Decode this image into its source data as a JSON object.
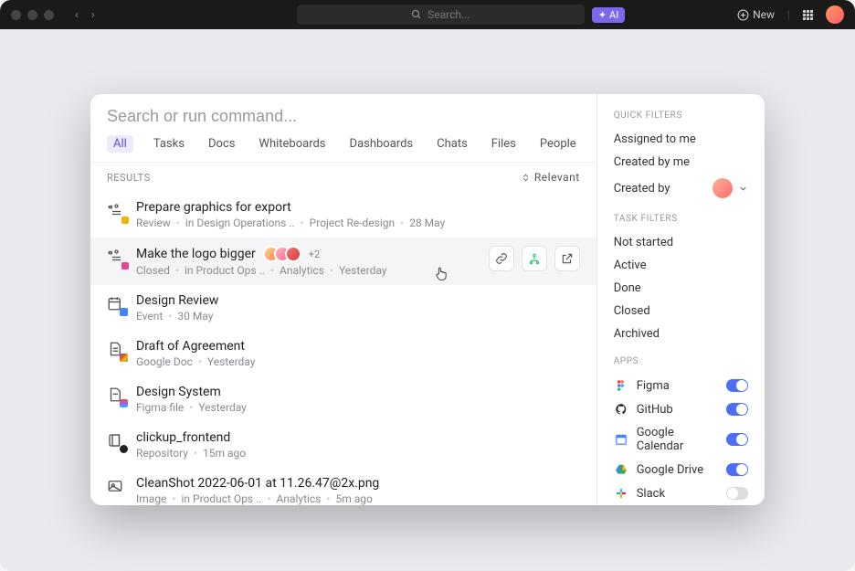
{
  "topbar": {
    "search_placeholder": "Search...",
    "ai_label": "AI",
    "new_label": "New"
  },
  "command": {
    "placeholder": "Search or run command...",
    "tabs": [
      "All",
      "Tasks",
      "Docs",
      "Whiteboards",
      "Dashboards",
      "Chats",
      "Files",
      "People"
    ],
    "results_label": "RESULTS",
    "sort_label": "Relevant"
  },
  "results": [
    {
      "title": "Prepare graphics for export",
      "status": "Review",
      "location": "in Design Operations ..",
      "extra": "Project Re-design",
      "time": "28 May",
      "type": "task",
      "status_color": "#f0b400"
    },
    {
      "title": "Make the logo bigger",
      "status": "Closed",
      "location": "in Product Ops ..",
      "extra": "Analytics",
      "time": "Yesterday",
      "type": "task",
      "status_color": "#e84393",
      "plus": "+2",
      "hovered": true
    },
    {
      "title": "Design Review",
      "status": "Event",
      "time": "30 May",
      "type": "event"
    },
    {
      "title": "Draft of Agreement",
      "status": "Google Doc",
      "time": "Yesterday",
      "type": "gdoc"
    },
    {
      "title": "Design System",
      "status": "Figma file",
      "time": "Yesterday",
      "type": "figma"
    },
    {
      "title": "clickup_frontend",
      "status": "Repository",
      "time": "15m ago",
      "type": "repo"
    },
    {
      "title": "CleanShot 2022-06-01 at 11.26.47@2x.png",
      "status": "Image",
      "location": "in Product Ops ..",
      "extra": "Analytics",
      "time": "5m ago",
      "type": "image"
    }
  ],
  "quick_filters_label": "QUICK FILTERS",
  "quick_filters": [
    "Assigned to me",
    "Created by me",
    "Created by"
  ],
  "task_filters_label": "TASK FILTERS",
  "task_filters": [
    "Not started",
    "Active",
    "Done",
    "Closed",
    "Archived"
  ],
  "apps_label": "APPS",
  "apps": [
    {
      "name": "Figma",
      "on": true,
      "color": "#a259ff"
    },
    {
      "name": "GitHub",
      "on": true,
      "color": "#222"
    },
    {
      "name": "Google Calendar",
      "on": true,
      "color": "#4285f4"
    },
    {
      "name": "Google Drive",
      "on": true,
      "color": "#34a853"
    },
    {
      "name": "Slack",
      "on": false,
      "color": "#611f69"
    }
  ]
}
